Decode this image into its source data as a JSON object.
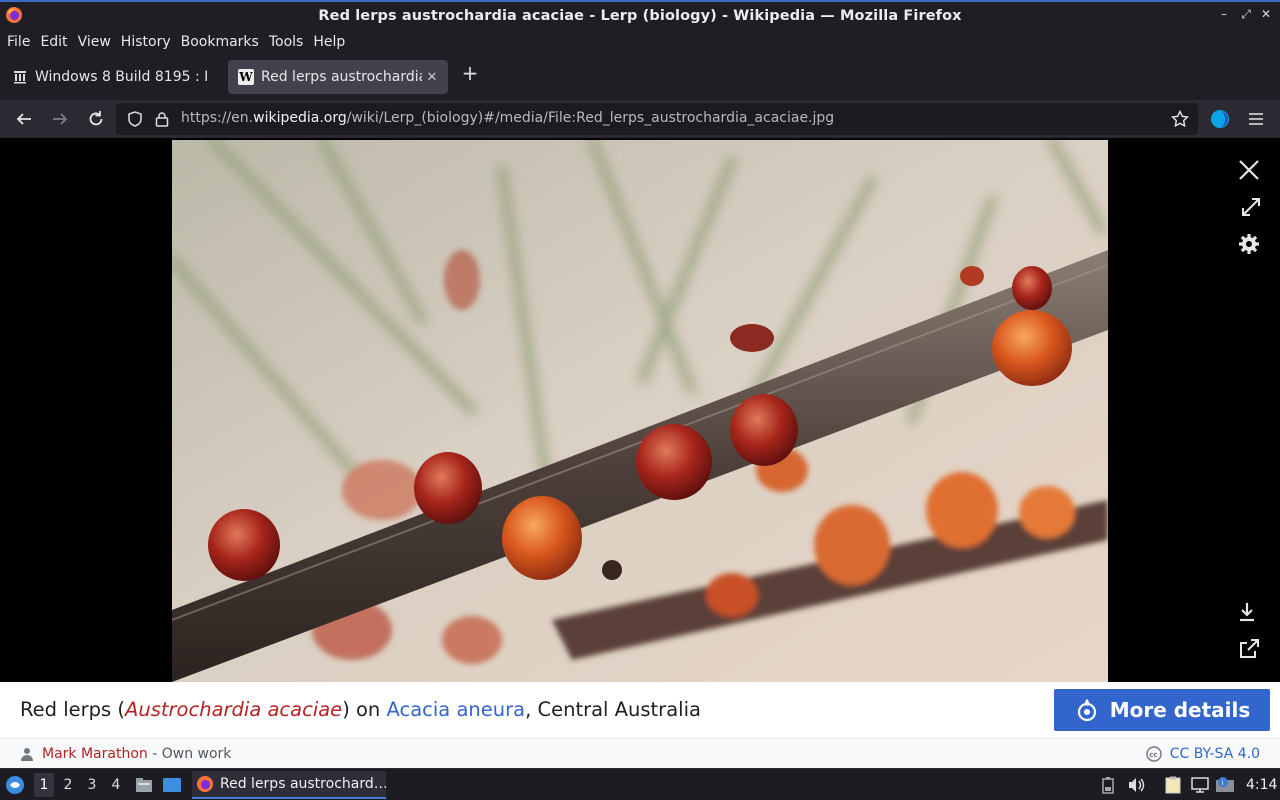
{
  "window": {
    "title": "Red lerps austrochardia acaciae - Lerp (biology) - Wikipedia — Mozilla Firefox",
    "minimize": "–",
    "maximize": "⤢",
    "close": "✕"
  },
  "menu": {
    "file": "File",
    "edit": "Edit",
    "view": "View",
    "history": "History",
    "bookmarks": "Bookmarks",
    "tools": "Tools",
    "help": "Help"
  },
  "tabs": [
    {
      "label": "Windows 8 Build 8195 : I"
    },
    {
      "label": "Red lerps austrochardia"
    }
  ],
  "url": {
    "prefix": "https://en.",
    "domain": "wikipedia.org",
    "path": "/wiki/Lerp_(biology)#/media/File:Red_lerps_austrochardia_acaciae.jpg"
  },
  "caption": {
    "before": "Red lerps (",
    "italic": "Austrochardia acaciae",
    "middle": ") on ",
    "link": "Acacia aneura",
    "after": ", Central Australia"
  },
  "more_details": "More details",
  "attribution": {
    "author": "Mark Marathon",
    "source": " - Own work",
    "license": "CC BY-SA 4.0"
  },
  "taskbar": {
    "workspaces": [
      "1",
      "2",
      "3",
      "4"
    ],
    "app_label": "Red lerps austrochard…",
    "clock": "4:14"
  },
  "colors": {
    "accent": "#3366cc",
    "link_red": "#b32424",
    "titlebar": "#1f1e25"
  }
}
